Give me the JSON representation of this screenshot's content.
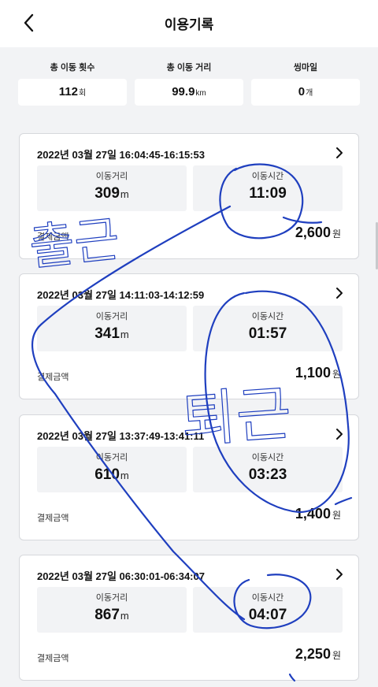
{
  "header": {
    "title": "이용기록"
  },
  "summary": [
    {
      "label": "총 이동 횟수",
      "value": "112",
      "unit": "회"
    },
    {
      "label": "총 이동 거리",
      "value": "99.9",
      "unit": "km"
    },
    {
      "label": "씽마일",
      "value": "0",
      "unit": "개"
    }
  ],
  "records": [
    {
      "datetime": "2022년 03월 27일 16:04:45-16:15:53",
      "distance_label": "이동거리",
      "distance": "309",
      "distance_unit": "m",
      "time_label": "이동시간",
      "time": "11:09",
      "pay_label": "결제금액",
      "pay": "2,600",
      "pay_unit": "원"
    },
    {
      "datetime": "2022년 03월 27일 14:11:03-14:12:59",
      "distance_label": "이동거리",
      "distance": "341",
      "distance_unit": "m",
      "time_label": "이동시간",
      "time": "01:57",
      "pay_label": "결제금액",
      "pay": "1,100",
      "pay_unit": "원"
    },
    {
      "datetime": "2022년 03월 27일 13:37:49-13:41:11",
      "distance_label": "이동거리",
      "distance": "610",
      "distance_unit": "m",
      "time_label": "이동시간",
      "time": "03:23",
      "pay_label": "결제금액",
      "pay": "1,400",
      "pay_unit": "원"
    },
    {
      "datetime": "2022년 03월 27일 06:30:01-06:34:07",
      "distance_label": "이동거리",
      "distance": "867",
      "distance_unit": "m",
      "time_label": "이동시간",
      "time": "04:07",
      "pay_label": "결제금액",
      "pay": "2,250",
      "pay_unit": "원"
    }
  ],
  "annotations": {
    "ink_color": "#1f3fbf",
    "word_commute_in": "출근",
    "word_commute_out": "퇴근"
  },
  "icons": {
    "back": "chevron-left-icon",
    "detail": "chevron-right-icon"
  }
}
